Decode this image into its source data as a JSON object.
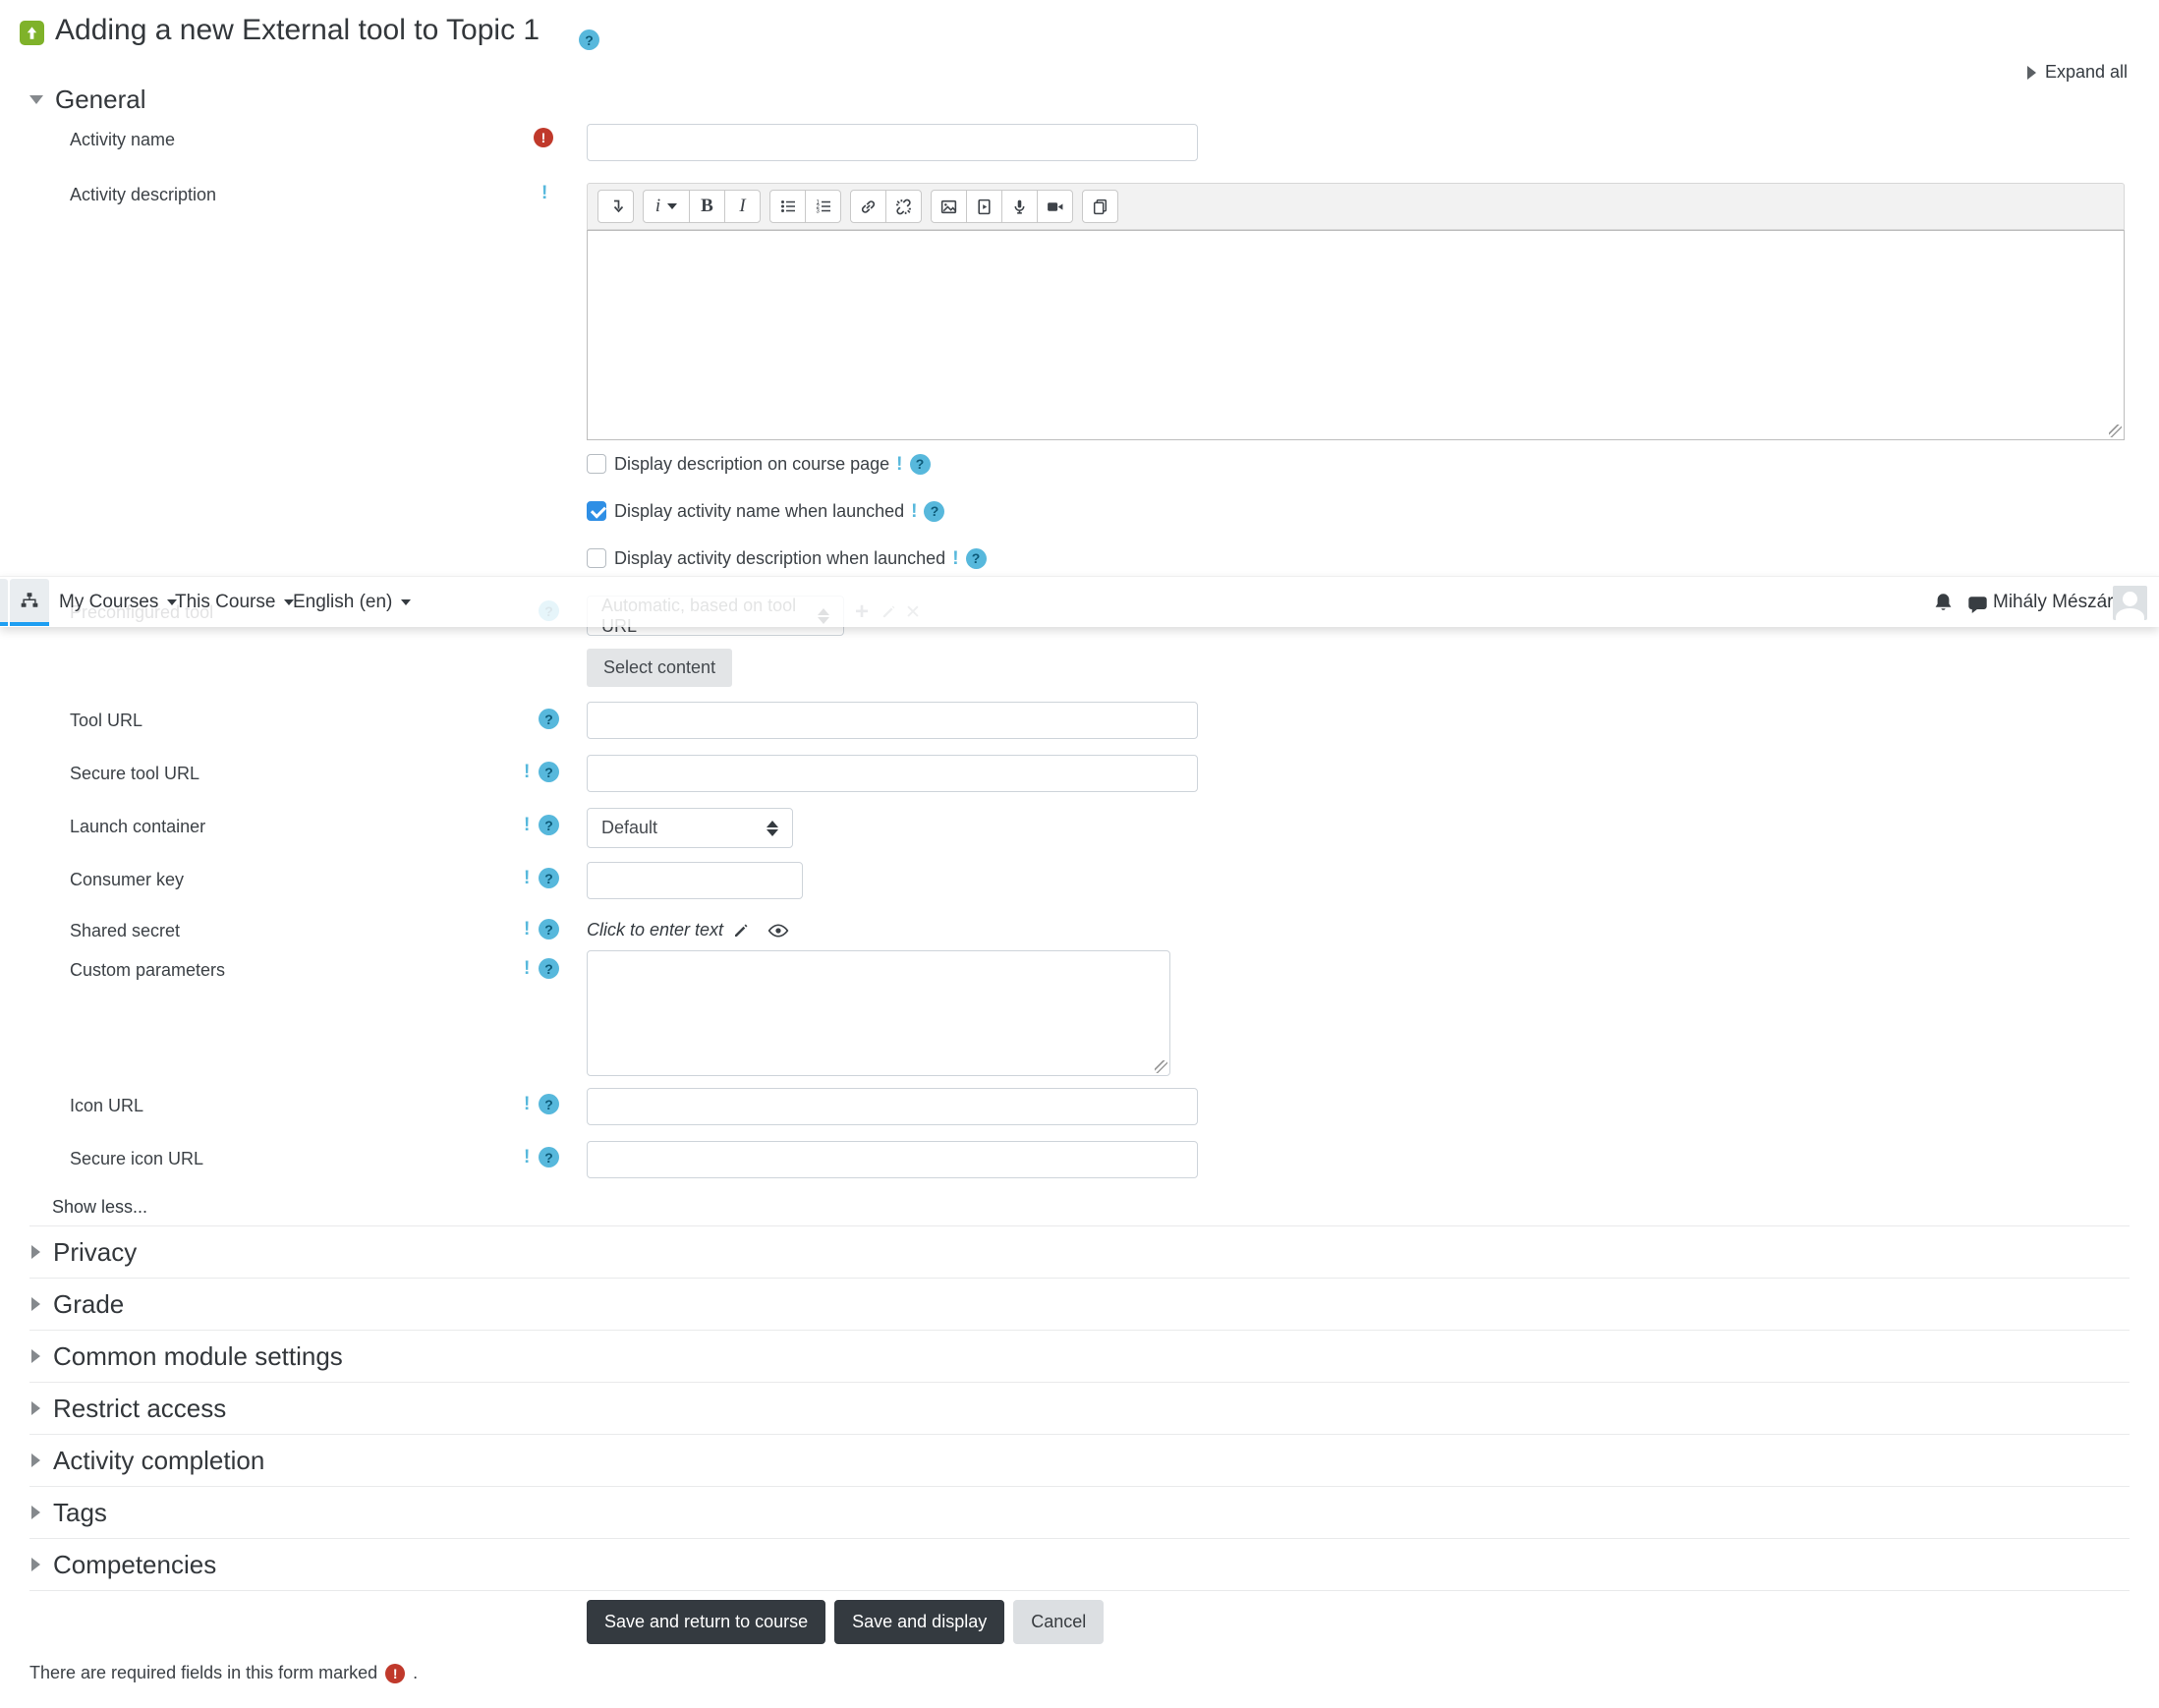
{
  "page": {
    "title": "Adding a new External tool to Topic 1",
    "expand_all_label": "Expand all",
    "required_note": "There are required fields in this form marked",
    "required_note_period": "."
  },
  "navbar": {
    "items": [
      {
        "label": "My Courses"
      },
      {
        "label": "This Course"
      },
      {
        "label": "English (en)"
      }
    ],
    "user_name": "Mihály Mészáros"
  },
  "general": {
    "heading": "General",
    "activity_name": {
      "label": "Activity name",
      "value": "",
      "required": true
    },
    "activity_description": {
      "label": "Activity description",
      "value": ""
    },
    "editor_toolbar_icons": [
      "collapse-toolbar",
      "paragraph-styles",
      "bold",
      "italic",
      "unordered-list",
      "ordered-list",
      "insert-link",
      "unlink",
      "insert-image",
      "insert-media",
      "record-audio",
      "record-video",
      "manage-files"
    ],
    "checkboxes": [
      {
        "label": "Display description on course page",
        "checked": false
      },
      {
        "label": "Display activity name when launched",
        "checked": true
      },
      {
        "label": "Display activity description when launched",
        "checked": false
      }
    ],
    "preconfigured_tool": {
      "label": "Preconfigured tool",
      "value": "Automatic, based on tool URL"
    },
    "select_content_label": "Select content",
    "fields": {
      "tool_url": {
        "label": "Tool URL",
        "value": ""
      },
      "secure_tool_url": {
        "label": "Secure tool URL",
        "value": ""
      },
      "launch_container": {
        "label": "Launch container",
        "value": "Default"
      },
      "consumer_key": {
        "label": "Consumer key",
        "value": ""
      },
      "shared_secret": {
        "label": "Shared secret",
        "value": "Click to enter text"
      },
      "custom_parameters": {
        "label": "Custom parameters",
        "value": ""
      },
      "icon_url": {
        "label": "Icon URL",
        "value": ""
      },
      "secure_icon_url": {
        "label": "Secure icon URL",
        "value": ""
      }
    },
    "show_less_label": "Show less..."
  },
  "sections": [
    {
      "label": "Privacy"
    },
    {
      "label": "Grade"
    },
    {
      "label": "Common module settings"
    },
    {
      "label": "Restrict access"
    },
    {
      "label": "Activity completion"
    },
    {
      "label": "Tags"
    },
    {
      "label": "Competencies"
    }
  ],
  "actions": {
    "save_return": "Save and return to course",
    "save_display": "Save and display",
    "cancel": "Cancel"
  },
  "colors": {
    "help_icon_blue": "#57b8dc",
    "required_red": "#c0392b",
    "checkbox_checked_blue": "#2f8fe5",
    "nav_active_underline": "#1e9ff2",
    "dark_button": "#343a40",
    "tool_icon_green": "#7fb22a"
  }
}
